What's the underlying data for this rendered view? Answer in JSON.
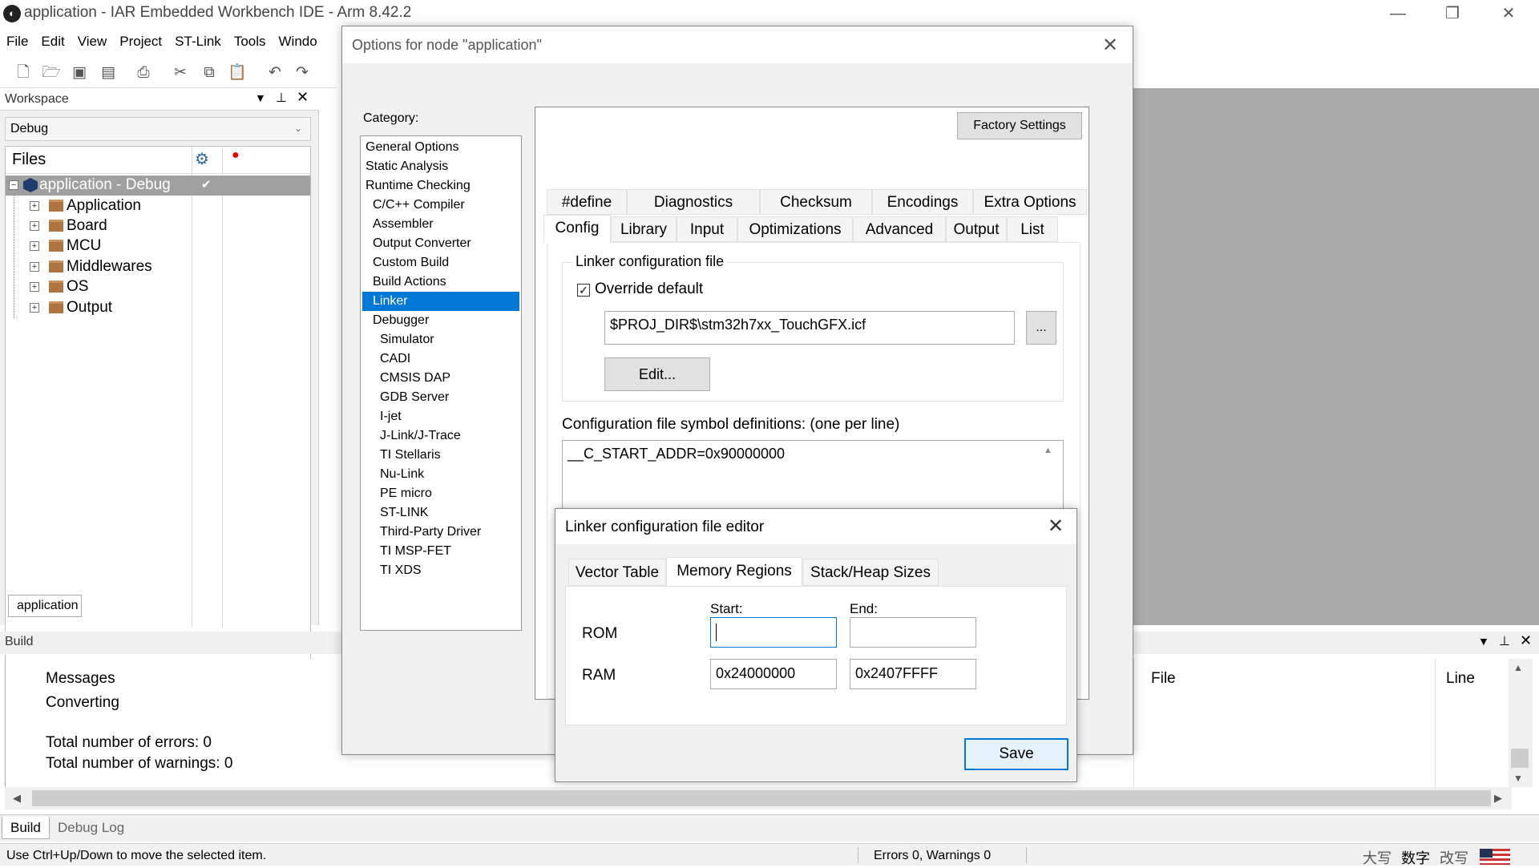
{
  "window": {
    "title": "application - IAR Embedded Workbench IDE - Arm 8.42.2",
    "controls": {
      "minimize": "—",
      "restore": "❐",
      "close": "✕"
    }
  },
  "menu": [
    "File",
    "Edit",
    "View",
    "Project",
    "ST-Link",
    "Tools",
    "Windo"
  ],
  "workspace": {
    "title": "Workspace",
    "config": "Debug",
    "files_header": "Files",
    "root": "application - Debug",
    "folders": [
      "Application",
      "Board",
      "MCU",
      "Middlewares",
      "OS",
      "Output"
    ],
    "bottom_tab": "application"
  },
  "options_dialog": {
    "title": "Options for node \"application\"",
    "category_label": "Category:",
    "categories": [
      {
        "label": "General Options",
        "indent": 0
      },
      {
        "label": "Static Analysis",
        "indent": 0
      },
      {
        "label": "Runtime Checking",
        "indent": 0
      },
      {
        "label": "C/C++ Compiler",
        "indent": 1
      },
      {
        "label": "Assembler",
        "indent": 1
      },
      {
        "label": "Output Converter",
        "indent": 1
      },
      {
        "label": "Custom Build",
        "indent": 1
      },
      {
        "label": "Build Actions",
        "indent": 1
      },
      {
        "label": "Linker",
        "indent": 1,
        "selected": true
      },
      {
        "label": "Debugger",
        "indent": 1
      },
      {
        "label": "Simulator",
        "indent": 2
      },
      {
        "label": "CADI",
        "indent": 2
      },
      {
        "label": "CMSIS DAP",
        "indent": 2
      },
      {
        "label": "GDB Server",
        "indent": 2
      },
      {
        "label": "I-jet",
        "indent": 2
      },
      {
        "label": "J-Link/J-Trace",
        "indent": 2
      },
      {
        "label": "TI Stellaris",
        "indent": 2
      },
      {
        "label": "Nu-Link",
        "indent": 2
      },
      {
        "label": "PE micro",
        "indent": 2
      },
      {
        "label": "ST-LINK",
        "indent": 2
      },
      {
        "label": "Third-Party Driver",
        "indent": 2
      },
      {
        "label": "TI MSP-FET",
        "indent": 2
      },
      {
        "label": "TI XDS",
        "indent": 2
      }
    ],
    "factory_settings": "Factory Settings",
    "tabs_row1": [
      "#define",
      "Diagnostics",
      "Checksum",
      "Encodings",
      "Extra Options"
    ],
    "tabs_row2": [
      "Config",
      "Library",
      "Input",
      "Optimizations",
      "Advanced",
      "Output",
      "List"
    ],
    "active_tab": "Config",
    "linker_group_title": "Linker configuration file",
    "override_label": "Override default",
    "override_checked": true,
    "config_path": "$PROJ_DIR$\\stm32h7xx_TouchGFX.icf",
    "browse_label": "...",
    "edit_label": "Edit...",
    "symdef_label": "Configuration file symbol definitions: (one per line)",
    "symdef_value": "__C_START_ADDR=0x90000000"
  },
  "editor_dialog": {
    "title": "Linker configuration file editor",
    "tabs": [
      "Vector Table",
      "Memory Regions",
      "Stack/Heap Sizes"
    ],
    "active_tab": "Memory Regions",
    "start_label": "Start:",
    "end_label": "End:",
    "rom_label": "ROM",
    "rom_start": "",
    "rom_end": "",
    "ram_label": "RAM",
    "ram_start": "0x24000000",
    "ram_end": "0x2407FFFF",
    "save_label": "Save"
  },
  "build": {
    "title": "Build",
    "messages_header": "Messages",
    "lines": [
      "Converting",
      "",
      "Total number of errors: 0",
      "Total number of warnings: 0"
    ],
    "file_header": "File",
    "line_header": "Line",
    "tabs": [
      "Build",
      "Debug Log"
    ]
  },
  "statusbar": {
    "hint": "Use Ctrl+Up/Down to move the selected item.",
    "errors": "Errors 0, Warnings 0",
    "ime": [
      "大写",
      "数字",
      "改写"
    ]
  },
  "colors": {
    "selection": "#0078d7",
    "workspace_bg": "#aaaaaa"
  }
}
